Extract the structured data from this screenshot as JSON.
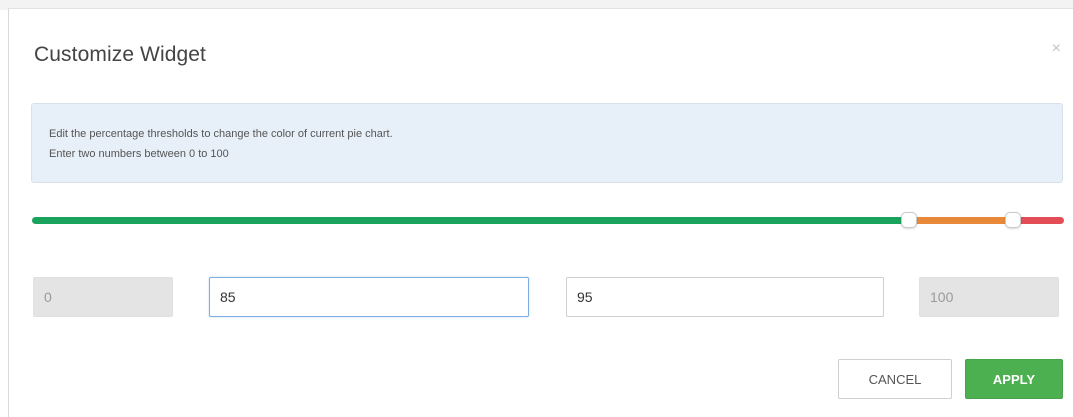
{
  "dialog": {
    "title": "Customize Widget",
    "close_glyph": "×",
    "close_icon": "close-icon"
  },
  "info": {
    "line1": "Edit the percentage thresholds to change the color of current pie chart.",
    "line2": "Enter two numbers between 0 to 100"
  },
  "slider": {
    "lower_threshold": 85,
    "upper_threshold": 95,
    "colors": {
      "green": "#1aa35c",
      "orange": "#e8893a",
      "red": "#e24d56"
    }
  },
  "fields": {
    "min_value": "0",
    "low_value": "85",
    "high_value": "95",
    "max_value": "100"
  },
  "buttons": {
    "cancel_label": "CANCEL",
    "apply_label": "APPLY",
    "apply_color": "#4cb050"
  }
}
